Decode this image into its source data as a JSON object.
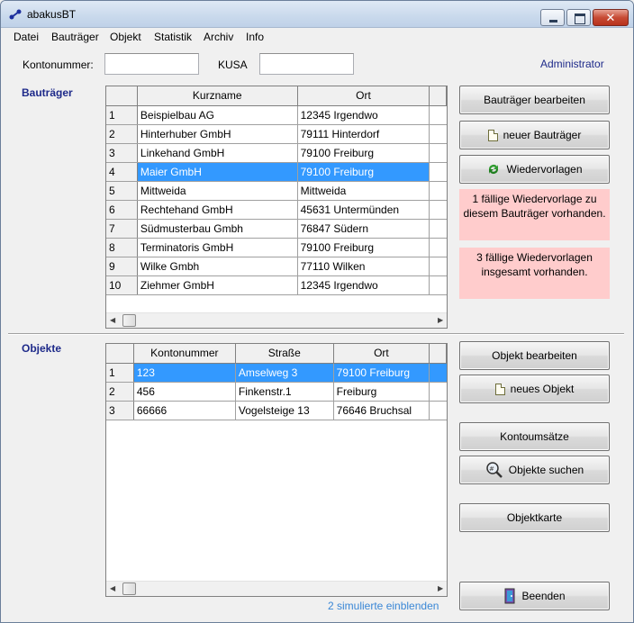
{
  "window": {
    "title": "abakusBT",
    "close_glyph": "✕"
  },
  "menu": [
    "Datei",
    "Bauträger",
    "Objekt",
    "Statistik",
    "Archiv",
    "Info"
  ],
  "search": {
    "kontonummer_label": "Kontonummer:",
    "kontonummer_value": "",
    "kusa_label": "KUSA",
    "kusa_value": "",
    "user": "Administrator"
  },
  "bautraeger": {
    "section_title": "Bauträger",
    "columns": [
      "Kurzname",
      "Ort"
    ],
    "selected_index": 3,
    "rows": [
      {
        "no": "1",
        "name": "Beispielbau AG",
        "ort": "12345 Irgendwo"
      },
      {
        "no": "2",
        "name": "Hinterhuber GmbH",
        "ort": "79111 Hinterdorf"
      },
      {
        "no": "3",
        "name": "Linkehand GmbH",
        "ort": "79100 Freiburg"
      },
      {
        "no": "4",
        "name": "Maier GmbH",
        "ort": "79100 Freiburg"
      },
      {
        "no": "5",
        "name": "Mittweida",
        "ort": "Mittweida"
      },
      {
        "no": "6",
        "name": "Rechtehand GmbH",
        "ort": "45631 Untermünden"
      },
      {
        "no": "7",
        "name": "Südmusterbau Gmbh",
        "ort": "76847 Südern"
      },
      {
        "no": "8",
        "name": "Terminatoris GmbH",
        "ort": "79100 Freiburg"
      },
      {
        "no": "9",
        "name": "Wilke Gmbh",
        "ort": "77110 Wilken"
      },
      {
        "no": "10",
        "name": "Ziehmer GmbH",
        "ort": "12345 Irgendwo"
      }
    ],
    "buttons": {
      "edit": "Bauträger bearbeiten",
      "new": "neuer Bauträger",
      "wiedervorlagen": "Wiedervorlagen"
    },
    "notice_1": "1  fällige Wiedervorlage zu diesem Bauträger vorhanden.",
    "notice_2": "3  fällige Wiedervorlagen insgesamt vorhanden."
  },
  "objekte": {
    "section_title": "Objekte",
    "columns": [
      "Kontonummer",
      "Straße",
      "Ort"
    ],
    "selected_index": 0,
    "rows": [
      {
        "no": "1",
        "konto": "123",
        "strasse": "Amselweg 3",
        "ort": "79100 Freiburg"
      },
      {
        "no": "2",
        "konto": "456",
        "strasse": "Finkenstr.1",
        "ort": "Freiburg"
      },
      {
        "no": "3",
        "konto": "66666",
        "strasse": "Vogelsteige 13",
        "ort": "76646 Bruchsal"
      }
    ],
    "buttons": {
      "edit": "Objekt bearbeiten",
      "new": "neues Objekt",
      "umsaetze": "Kontoumsätze",
      "search": "Objekte suchen",
      "karte": "Objektkarte",
      "quit": "Beenden"
    },
    "footer_link": "2 simulierte einblenden"
  },
  "colors": {
    "accent": "#3399ff",
    "section_title": "#1e2a8a",
    "notice_bg": "#ffcccc",
    "link": "#3a87d6"
  }
}
